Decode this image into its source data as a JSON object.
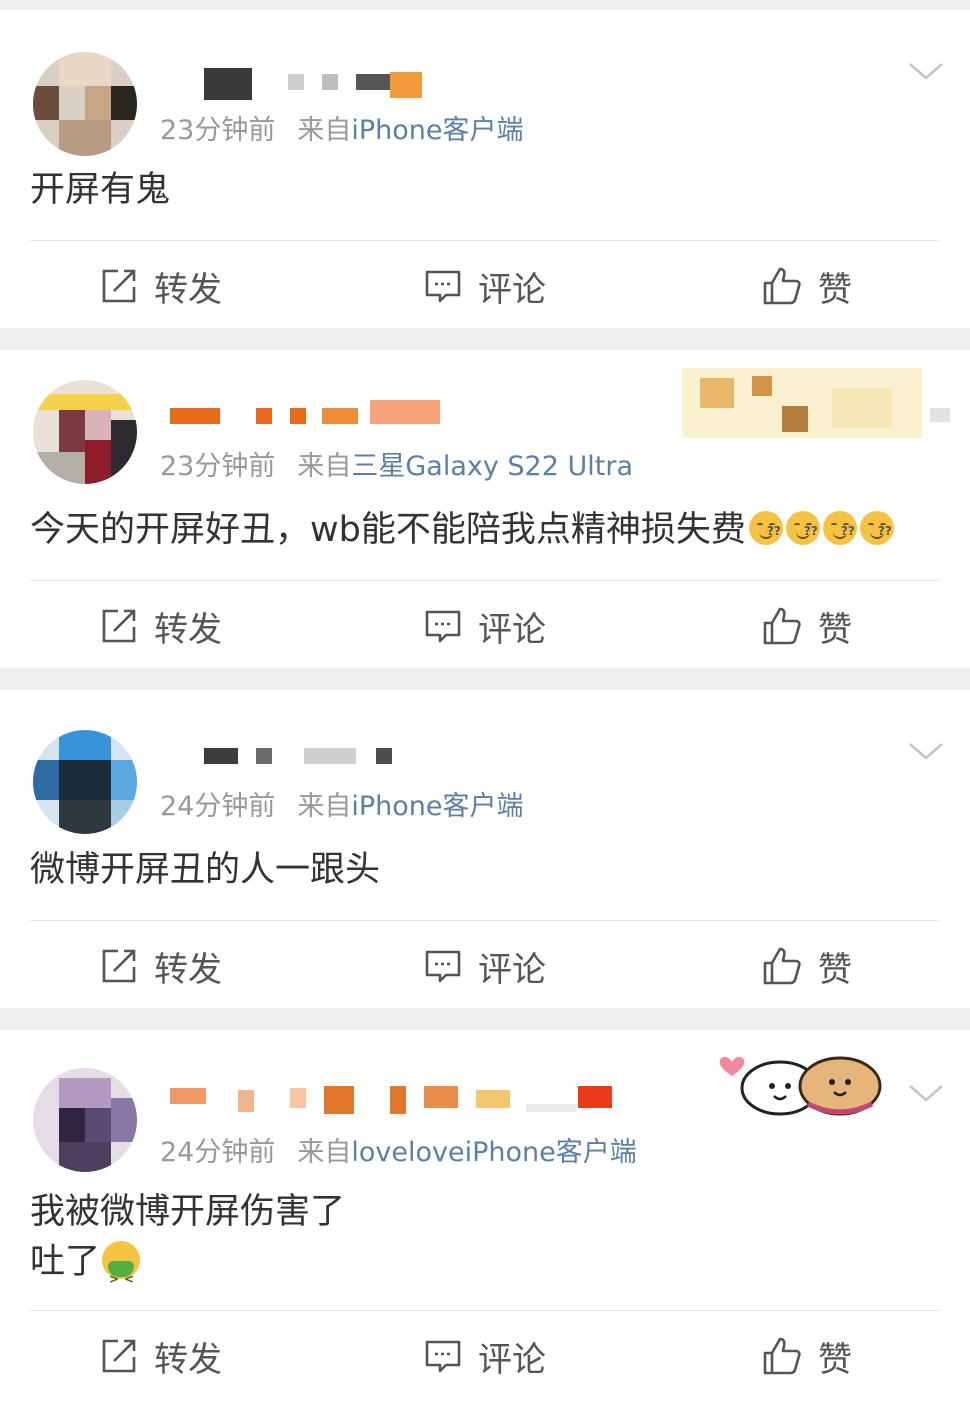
{
  "actions": {
    "repost": "转发",
    "comment": "评论",
    "like": "赞"
  },
  "posts": [
    {
      "time": "23分钟前",
      "from": "来自",
      "source": "iPhone客户端",
      "text": "开屏有鬼"
    },
    {
      "time": "23分钟前",
      "from": "来自",
      "source": "三星Galaxy S22 Ultra",
      "text": "今天的开屏好丑，wb能不能陪我点精神损失费"
    },
    {
      "time": "24分钟前",
      "from": "来自",
      "source": "iPhone客户端",
      "text": "微博开屏丑的人一跟头"
    },
    {
      "time": "24分钟前",
      "from": "来自",
      "source": "loveloveiPhone客户端",
      "text_line1": "我被微博开屏伤害了",
      "text_line2": "吐了"
    }
  ],
  "icons": {
    "repost": "repost-icon",
    "comment": "comment-icon",
    "like": "thumbs-up-icon",
    "menu": "chevron-down-icon",
    "emoji_dizzy": "dizzy-face-emoji",
    "emoji_vomit": "vomit-face-emoji"
  },
  "colors": {
    "source_link": "#5d7fa6",
    "meta": "#999999",
    "text": "#333333",
    "separator": "#efefef"
  }
}
